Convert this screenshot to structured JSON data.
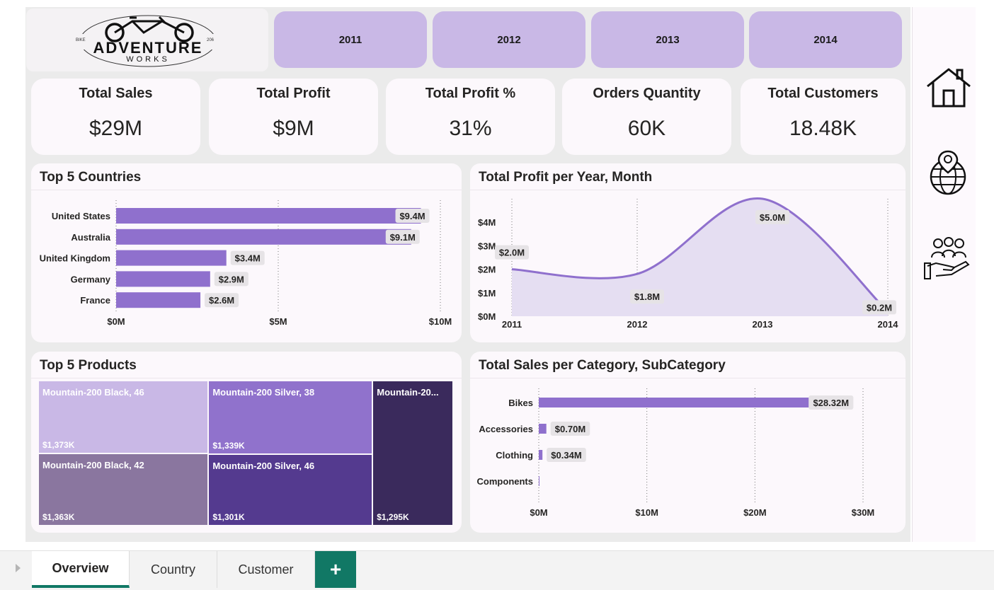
{
  "logo": {
    "brand_top": "ADVENTURE",
    "brand_bottom": "WORKS",
    "small_left": "BIKE",
    "small_right": "206"
  },
  "year_filters": [
    "2011",
    "2012",
    "2013",
    "2014"
  ],
  "kpis": [
    {
      "label": "Total Sales",
      "value": "$29M"
    },
    {
      "label": "Total Profit",
      "value": "$9M"
    },
    {
      "label": "Total Profit %",
      "value": "31%"
    },
    {
      "label": "Orders Quantity",
      "value": "60K"
    },
    {
      "label": "Total Customers",
      "value": "18.48K"
    }
  ],
  "panels": {
    "countries_title": "Top 5 Countries",
    "profit_title": "Total Profit per Year, Month",
    "products_title": "Top 5 Products",
    "category_title": "Total Sales per Category, SubCategory"
  },
  "chart_data": [
    {
      "type": "bar",
      "orientation": "horizontal",
      "title": "Top 5 Countries",
      "categories": [
        "United States",
        "Australia",
        "United Kingdom",
        "Germany",
        "France"
      ],
      "values": [
        9.4,
        9.1,
        3.4,
        2.9,
        2.6
      ],
      "data_labels": [
        "$9.4M",
        "$9.1M",
        "$3.4M",
        "$2.9M",
        "$2.6M"
      ],
      "x_ticks": [
        "$0M",
        "$5M",
        "$10M"
      ],
      "xlim": [
        0,
        10
      ],
      "color": "#8f70cd"
    },
    {
      "type": "area",
      "title": "Total Profit per Year, Month",
      "x": [
        "2011",
        "2012",
        "2013",
        "2014"
      ],
      "values": [
        2.0,
        1.8,
        5.0,
        0.2
      ],
      "data_labels": [
        "$2.0M",
        "$1.8M",
        "$5.0M",
        "$0.2M"
      ],
      "y_ticks": [
        "$0M",
        "$1M",
        "$2M",
        "$3M",
        "$4M"
      ],
      "ylim": [
        0,
        5
      ],
      "color": "#8f70cd"
    },
    {
      "type": "treemap",
      "title": "Top 5 Products",
      "items": [
        {
          "name": "Mountain-200 Black, 46",
          "value": 1373,
          "label": "$1,373K",
          "color": "#c9b8e6"
        },
        {
          "name": "Mountain-200 Black, 42",
          "value": 1363,
          "label": "$1,363K",
          "color": "#8a769f"
        },
        {
          "name": "Mountain-200 Silver, 38",
          "value": 1339,
          "label": "$1,339K",
          "color": "#9072cc"
        },
        {
          "name": "Mountain-200 Silver, 46",
          "value": 1301,
          "label": "$1,301K",
          "color": "#543a8f"
        },
        {
          "name": "Mountain-20...",
          "value": 1295,
          "label": "$1,295K",
          "color": "#3a2a5c"
        }
      ]
    },
    {
      "type": "bar",
      "orientation": "horizontal",
      "title": "Total Sales per Category, SubCategory",
      "categories": [
        "Bikes",
        "Accessories",
        "Clothing",
        "Components"
      ],
      "values": [
        28.32,
        0.7,
        0.34,
        0
      ],
      "data_labels": [
        "$28.32M",
        "$0.70M",
        "$0.34M",
        ""
      ],
      "x_ticks": [
        "$0M",
        "$10M",
        "$20M",
        "$30M"
      ],
      "xlim": [
        0,
        30
      ],
      "color": "#8f70cd"
    }
  ],
  "tabs": {
    "overview": "Overview",
    "country": "Country",
    "customer": "Customer",
    "add": "+"
  }
}
